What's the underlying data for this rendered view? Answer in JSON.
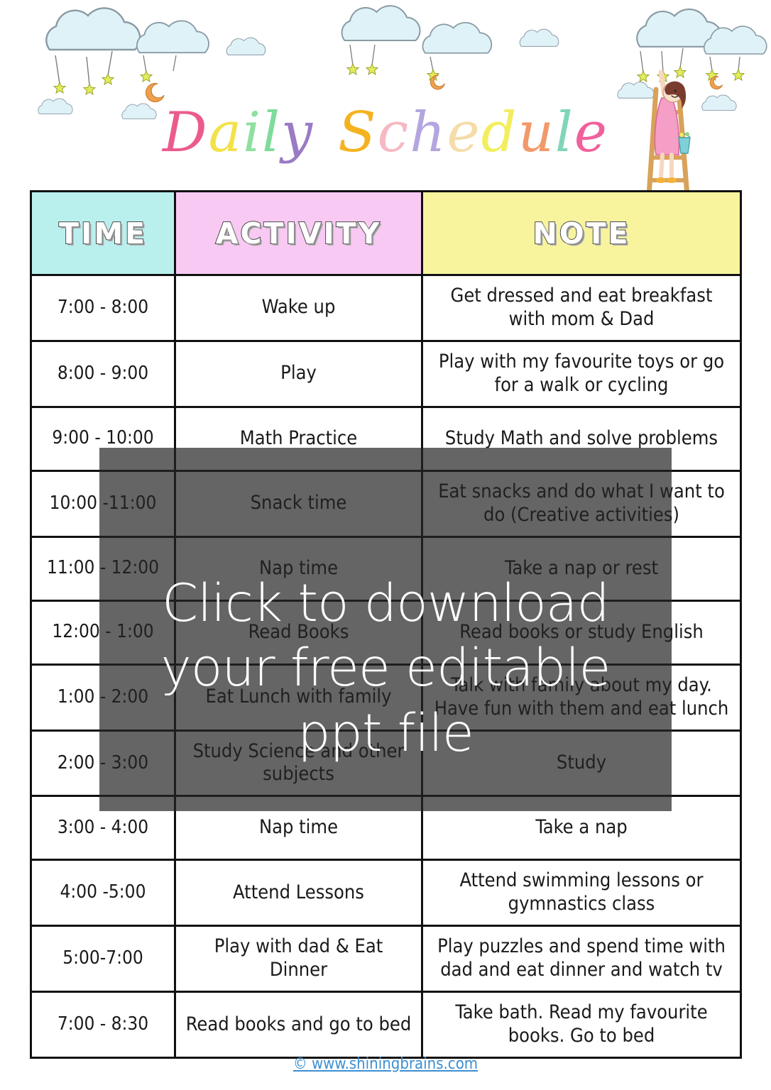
{
  "title": {
    "text": "Daily Schedule",
    "letters": [
      {
        "ch": "D",
        "color": "#eb5b8e"
      },
      {
        "ch": "a",
        "color": "#f2e24a"
      },
      {
        "ch": "i",
        "color": "#8fe0a0"
      },
      {
        "ch": "l",
        "color": "#7fdb9a"
      },
      {
        "ch": "y",
        "color": "#9b7bc4"
      },
      {
        "ch": " ",
        "color": "transparent"
      },
      {
        "ch": "S",
        "color": "#f5b220"
      },
      {
        "ch": "c",
        "color": "#f6b9c3"
      },
      {
        "ch": "h",
        "color": "#b3a6e0"
      },
      {
        "ch": "e",
        "color": "#f5dca8"
      },
      {
        "ch": "d",
        "color": "#f2ee5e"
      },
      {
        "ch": "u",
        "color": "#f2996a"
      },
      {
        "ch": "l",
        "color": "#7fd6b6"
      },
      {
        "ch": "e",
        "color": "#f0609b"
      }
    ]
  },
  "decoration": {
    "cloud_color": "#dff2f8",
    "cloud_stroke": "#8a9aa3",
    "star_color": "#d7e04a",
    "moon_color": "#f0a04b",
    "girl_dress_color": "#f59ec6",
    "girl_hair_color": "#7a3c2e",
    "ladder_color": "#d8a25a",
    "bucket_color": "#7fd0d8",
    "items": [
      "cloud-icon",
      "cloud-icon",
      "cloud-icon",
      "cloud-icon",
      "cloud-icon",
      "cloud-icon",
      "cloud-icon",
      "cloud-icon",
      "cloud-icon",
      "cloud-icon",
      "star-icon",
      "moon-icon",
      "girl-on-ladder-icon"
    ]
  },
  "table": {
    "headers": [
      "TIME",
      "ACTIVITY",
      "NOTE"
    ],
    "header_colors": {
      "time": "#b9f0ee",
      "activity": "#f8c9f2",
      "note": "#f8f49e"
    },
    "rows": [
      {
        "time": "7:00 - 8:00",
        "activity": "Wake up",
        "note": "Get dressed and eat breakfast with mom & Dad"
      },
      {
        "time": "8:00 - 9:00",
        "activity": "Play",
        "note": "Play with my favourite toys or go for a walk or cycling"
      },
      {
        "time": "9:00 - 10:00",
        "activity": "Math Practice",
        "note": "Study Math and solve problems"
      },
      {
        "time": "10:00 -11:00",
        "activity": "Snack time",
        "note": "Eat snacks and do what I want to do (Creative activities)"
      },
      {
        "time": "11:00 - 12:00",
        "activity": "Nap time",
        "note": "Take a nap or rest"
      },
      {
        "time": "12:00 - 1:00",
        "activity": "Read Books",
        "note": "Read books or study English"
      },
      {
        "time": "1:00 - 2:00",
        "activity": "Eat Lunch with family",
        "note": "Talk with family about my day. Have fun with them and eat lunch"
      },
      {
        "time": "2:00 - 3:00",
        "activity": "Study Science and other subjects",
        "note": "Study"
      },
      {
        "time": "3:00 - 4:00",
        "activity": "Nap time",
        "note": "Take a nap"
      },
      {
        "time": "4:00 -5:00",
        "activity": "Attend Lessons",
        "note": "Attend swimming lessons or gymnastics class"
      },
      {
        "time": "5:00-7:00",
        "activity": "Play with dad & Eat Dinner",
        "note": "Play puzzles and spend time with dad and eat dinner and watch tv"
      },
      {
        "time": "7:00 - 8:30",
        "activity": "Read books and go to bed",
        "note": "Take bath. Read my favourite books. Go to bed"
      }
    ]
  },
  "overlay": {
    "line1": "Click to download",
    "line2": "your free editable",
    "line3": "ppt file",
    "background_color": "#232323",
    "text_color": "#ffffff"
  },
  "footer": {
    "link_text": "© www.shiningbrains.com",
    "link_color": "#3d8fd1"
  }
}
